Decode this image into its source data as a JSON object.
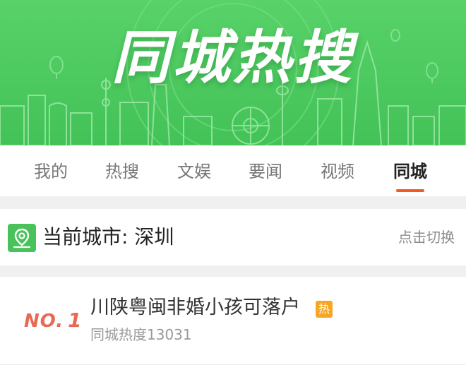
{
  "banner": {
    "title": "同城热搜",
    "colors": {
      "background": "#4cc95f",
      "title": "#ffffff"
    }
  },
  "tabs": [
    {
      "label": "我的",
      "active": false
    },
    {
      "label": "热搜",
      "active": false
    },
    {
      "label": "文娱",
      "active": false
    },
    {
      "label": "要闻",
      "active": false
    },
    {
      "label": "视频",
      "active": false
    },
    {
      "label": "同城",
      "active": true
    }
  ],
  "accent_color": "#f15a24",
  "city": {
    "label": "当前城市: 深圳",
    "icon": "location-pin-icon",
    "switch_label": "点击切换"
  },
  "list": [
    {
      "rank_prefix": "NO.",
      "rank": "1",
      "title": "川陕粤闽非婚小孩可落户",
      "badge": "热",
      "heat": "同城热度13031"
    }
  ]
}
